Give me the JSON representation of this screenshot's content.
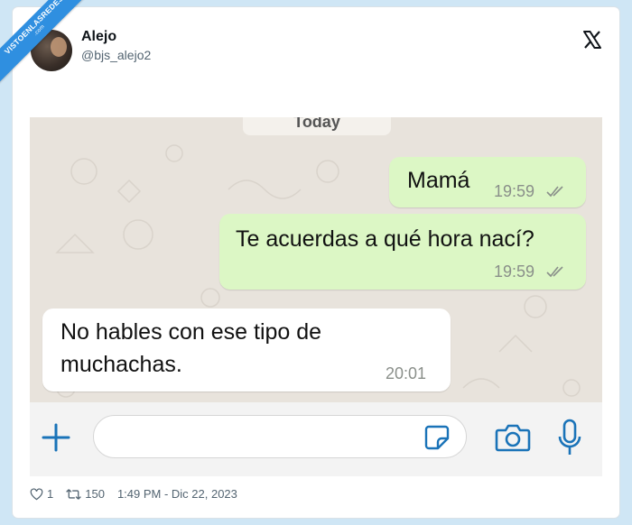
{
  "ribbon": {
    "text": "VISTOENLASREDES",
    "sub": ".com"
  },
  "author": {
    "name": "Alejo",
    "handle": "@bjs_alejo2"
  },
  "chat": {
    "date_label": "Today",
    "messages": [
      {
        "direction": "outgoing",
        "text": "Mamá",
        "time": "19:59",
        "status": "read"
      },
      {
        "direction": "outgoing",
        "text": "Te acuerdas a qué hora nací?",
        "time": "19:59",
        "status": "read"
      },
      {
        "direction": "incoming",
        "line1": "No hables con ese tipo de",
        "line2": "muchachas.",
        "time": "20:01"
      }
    ]
  },
  "footer": {
    "likes": "1",
    "retweets": "150",
    "timestamp": "1:49 PM - Dic 22, 2023"
  },
  "colors": {
    "accent": "#1d9bf0",
    "outgoing_bubble": "#dcf7c5",
    "whatsapp_icon": "#1a73b8"
  }
}
